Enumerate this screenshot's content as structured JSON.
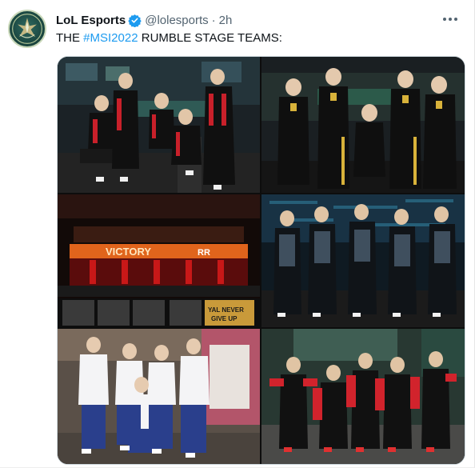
{
  "tweet": {
    "author_name": "LoL Esports",
    "author_handle": "@lolesports",
    "separator": "·",
    "timestamp": "2h",
    "text_prefix": "THE ",
    "hashtag": "#MSI2022",
    "text_suffix": " RUMBLE STAGE TEAMS:"
  },
  "icons": {
    "avatar": "msi-logo-icon",
    "verified": "verified-badge-icon",
    "more": "more-options-icon"
  },
  "colors": {
    "hashtag": "#1d9bf0",
    "verified": "#1d9bf0",
    "muted_text": "#536471"
  },
  "media": {
    "photos": [
      {
        "team": "team-photo-top-left"
      },
      {
        "team": "team-photo-top-right"
      },
      {
        "team": "team-photo-middle-left"
      },
      {
        "team": "team-photo-middle-right"
      },
      {
        "team": "team-photo-bottom-left"
      },
      {
        "team": "team-photo-bottom-right"
      }
    ],
    "banner_text": "VICTORY",
    "banner_text_2": "RR",
    "slogan_line_1": "YAL NEVER",
    "slogan_line_2": "GIVE UP"
  }
}
